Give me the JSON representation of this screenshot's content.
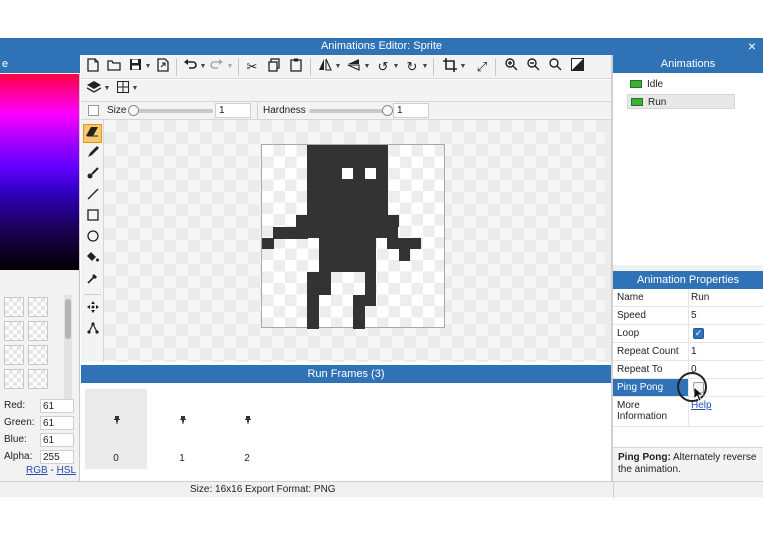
{
  "window": {
    "title": "Animations Editor: Sprite",
    "close_icon": "×"
  },
  "left_panel": {
    "header_text": "e",
    "color_rows": [
      {
        "label": "Red:",
        "value": "61"
      },
      {
        "label": "Green:",
        "value": "61"
      },
      {
        "label": "Blue:",
        "value": "61"
      },
      {
        "label": "Alpha:",
        "value": "255"
      }
    ],
    "mode_links": {
      "rgb": "RGB",
      "separator": " - ",
      "hsl": "HSL"
    }
  },
  "toolbar": {
    "size_label": "Size",
    "size_value": "1",
    "hardness_label": "Hardness",
    "hardness_value": "1"
  },
  "frames_panel": {
    "title": "Run Frames (3)",
    "frames": [
      {
        "index": "0"
      },
      {
        "index": "1"
      },
      {
        "index": "2"
      }
    ]
  },
  "animations_panel": {
    "title": "Animations",
    "items": [
      {
        "name": "Idle"
      },
      {
        "name": "Run"
      }
    ]
  },
  "properties_panel": {
    "title": "Animation Properties",
    "rows": [
      {
        "key": "Name",
        "value": "Run"
      },
      {
        "key": "Speed",
        "value": "5"
      },
      {
        "key": "Loop",
        "value": "true"
      },
      {
        "key": "Repeat Count",
        "value": "1"
      },
      {
        "key": "Repeat To",
        "value": "0"
      },
      {
        "key": "Ping Pong",
        "value": "false"
      },
      {
        "key": "More Information",
        "value": "Help"
      }
    ],
    "description_bold": "Ping Pong:",
    "description_text": " Alternately reverse the animation."
  },
  "status_bar": {
    "size": "Size: 16x16",
    "export_format": "Export Format: PNG"
  },
  "colors": {
    "accent": "#2f72b6",
    "sprite": "#333333",
    "selected_tool": "#f7c96a"
  }
}
